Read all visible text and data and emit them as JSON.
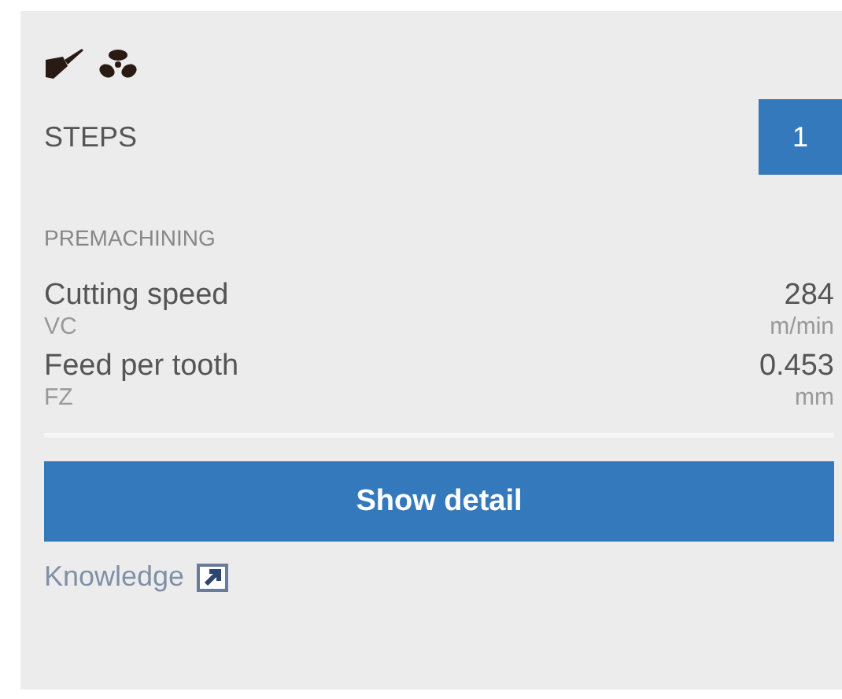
{
  "steps": {
    "label": "STEPS",
    "count": "1"
  },
  "section": "PREMACHINING",
  "parameters": [
    {
      "name": "Cutting speed",
      "symbol": "VC",
      "value": "284",
      "unit": "m/min"
    },
    {
      "name": "Feed per tooth",
      "symbol": "FZ",
      "value": "0.453",
      "unit": "mm"
    }
  ],
  "button": "Show detail",
  "link": "Knowledge"
}
